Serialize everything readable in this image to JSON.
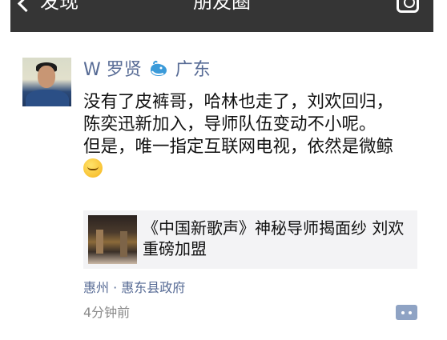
{
  "navbar": {
    "back_label": "发现",
    "title": "朋友圈",
    "camera_icon": "camera-icon"
  },
  "post": {
    "author_name": "W 罗贤",
    "author_suffix": "广东",
    "author_icon": "whale-icon",
    "text_lines": [
      "没有了皮裤哥，哈林也走了，刘欢回归，陈奕迅新加入，导师队伍变动不小呢。",
      "但是，唯一指定互联网电视，依然是微鲸"
    ],
    "emoji": "blush-emoji-icon",
    "link": {
      "title": "《中国新歌声》神秘导师揭面纱 刘欢重磅加盟"
    },
    "location": "惠州 · 惠东县政府",
    "time": "4分钟前",
    "comment_icon": "comment-icon"
  },
  "colors": {
    "navbar_bg": "#353535",
    "link_blue": "#576b95",
    "card_bg": "#f3f3f5",
    "comment_button": "#8fa3c4"
  }
}
